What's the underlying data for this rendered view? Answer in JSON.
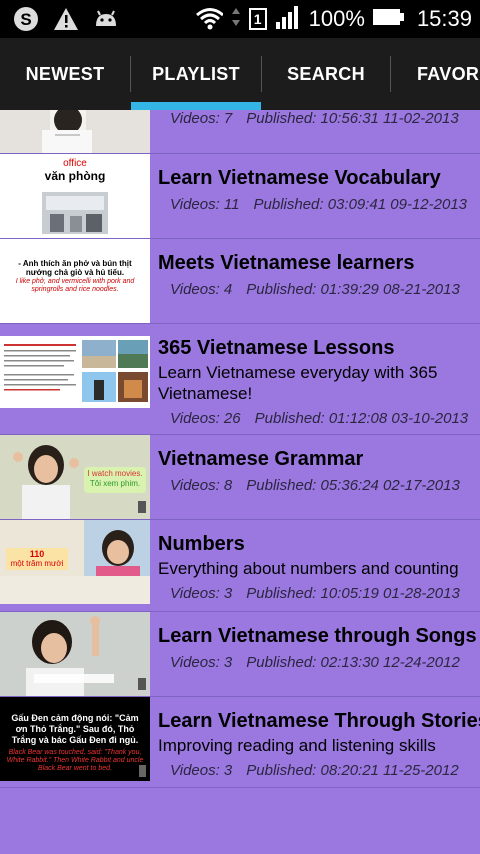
{
  "status": {
    "battery": "100%",
    "time": "15:39",
    "sim": "1"
  },
  "tabs": [
    {
      "label": "NEWEST"
    },
    {
      "label": "PLAYLIST"
    },
    {
      "label": "SEARCH"
    },
    {
      "label": "FAVORIT"
    }
  ],
  "active_tab": "PLAYLIST",
  "playlists": [
    {
      "title": "",
      "description": "",
      "videos": "Videos: 7",
      "published": "Published: 10:56:31 11-02-2013",
      "thumb_text": []
    },
    {
      "title": "Learn Vietnamese Vocabulary",
      "description": "",
      "videos": "Videos: 11",
      "published": "Published: 03:09:41 09-12-2013",
      "thumb_text": [
        "office",
        "văn phòng"
      ]
    },
    {
      "title": "Meets Vietnamese learners",
      "description": "",
      "videos": "Videos: 4",
      "published": "Published: 01:39:29 08-21-2013",
      "thumb_text": [
        "- Anh thích ăn phở và bún thịt nướng chả giò và hủ tiếu.",
        "I like phở, and vermicelli with pork and springrolls and rice noodles."
      ]
    },
    {
      "title": "365 Vietnamese Lessons",
      "description": "Learn Vietnamese everyday with 365 Vietnamese!",
      "videos": "Videos: 26",
      "published": "Published: 01:12:08 03-10-2013",
      "thumb_text": []
    },
    {
      "title": "Vietnamese Grammar",
      "description": "",
      "videos": "Videos: 8",
      "published": "Published: 05:36:24 02-17-2013",
      "thumb_text": [
        "I watch movies.",
        "Tôi xem phim."
      ]
    },
    {
      "title": "Numbers",
      "description": "Everything about numbers and counting",
      "videos": "Videos: 3",
      "published": "Published: 10:05:19 01-28-2013",
      "thumb_text": [
        "110",
        "một trăm mười"
      ]
    },
    {
      "title": "Learn Vietnamese through Songs",
      "description": "",
      "videos": "Videos: 3",
      "published": "Published: 02:13:30 12-24-2012",
      "thumb_text": []
    },
    {
      "title": "Learn Vietnamese Through Stories",
      "description": "Improving reading and listening skills",
      "videos": "Videos: 3",
      "published": "Published: 08:20:21 11-25-2012",
      "thumb_text": [
        "Gấu Đen cảm động nói: \"Cảm ơn Thỏ Trắng.\" Sau đó, Thỏ Trắng và bác Gấu Đen đi ngủ.",
        "Black Bear was touched, said: \"Thank you, White Rabbit.\" Then White Rabbit and uncle Black Bear went to bed."
      ]
    }
  ],
  "colors": {
    "list_bg": "#9a78e0",
    "tab_indicator": "#33b5e5",
    "tabbar_bg": "#1c1c1c"
  }
}
